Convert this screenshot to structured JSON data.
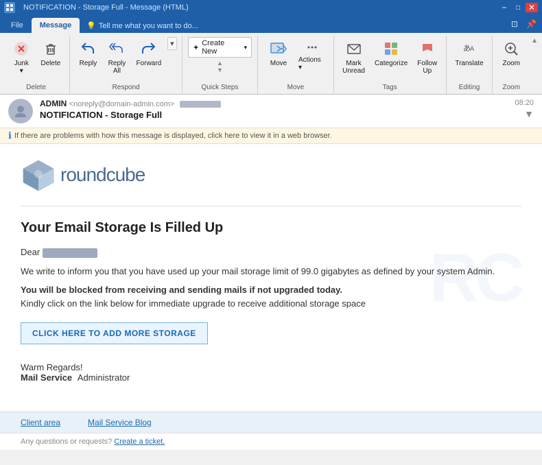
{
  "titlebar": {
    "title": "NOTIFICATION - Storage Full - Message (HTML)",
    "controls": [
      "─",
      "□",
      "✕"
    ],
    "icon_label": "W"
  },
  "ribbon_tabs": {
    "tabs": [
      "File",
      "Message",
      "Tell me what you want to do..."
    ],
    "active": "Message"
  },
  "ribbon": {
    "groups": {
      "delete": {
        "label": "Delete",
        "buttons": {
          "junk_label": "Junk ▾",
          "delete_label": "Delete"
        }
      },
      "respond": {
        "label": "Respond",
        "buttons": [
          "Reply",
          "Reply All",
          "Forward",
          "▾"
        ]
      },
      "quick_steps": {
        "label": "Quick Steps",
        "items": [
          "Create New"
        ]
      },
      "move": {
        "label": "Move",
        "buttons": [
          "Move",
          "Actions ▾"
        ]
      },
      "tags": {
        "label": "Tags",
        "buttons": [
          "Mark Unread",
          "Categorize",
          "Follow Up",
          "Translate"
        ]
      },
      "editing": {
        "label": "Editing",
        "buttons": [
          "Zoom"
        ]
      },
      "zoom": {
        "label": "Zoom",
        "buttons": [
          "Zoom"
        ]
      }
    }
  },
  "email": {
    "from_name": "ADMIN",
    "from_email": "<noreply@domain-admin.com>",
    "subject": "NOTIFICATION - Storage Full",
    "time": "08:20",
    "avatar_icon": "👤",
    "info_bar": "If there are problems with how this message is displayed, click here to view it in a web browser.",
    "body": {
      "logo_text": "roundcube",
      "heading": "Your Email Storage Is Filled Up",
      "dear": "Dear",
      "recipient_blurred": true,
      "para1": "We write to inform you that you have used up your mail storage limit of 99.0 gigabytes as defined by your system Admin.",
      "para2_bold": "You will be blocked from receiving and sending mails if not upgraded today.",
      "para2_normal": "Kindly click on the link below for immediate upgrade to receive additional storage space",
      "cta_button": "CLICK HERE TO ADD MORE STORAGE",
      "signature_greeting": "Warm Regards!",
      "signature_name": "Mail Service",
      "signature_role": "Administrator",
      "footer_links": [
        "Client area",
        "Mail Service Blog"
      ],
      "footer_note": "Any questions or requests?",
      "footer_ticket_link": "Create a ticket."
    }
  }
}
